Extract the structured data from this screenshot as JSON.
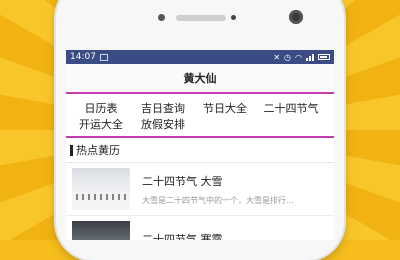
{
  "statusbar": {
    "time": "14:07"
  },
  "app": {
    "title": "黄大仙"
  },
  "menu": {
    "row1": [
      "日历表",
      "吉日查询",
      "节日大全",
      "二十四节气"
    ],
    "row2": [
      "开运大全",
      "放假安排"
    ]
  },
  "section": {
    "title": "热点黄历"
  },
  "news": [
    {
      "title": "二十四节气 大雪",
      "summary": "大雪是二十四节气中的一个，大雪是排行..."
    },
    {
      "title": "二十四节气 寒露",
      "summary": ""
    }
  ],
  "colors": {
    "background": "#f6bd1c",
    "statusbar": "#3b4b84",
    "accent_line": "#c73bb0"
  }
}
